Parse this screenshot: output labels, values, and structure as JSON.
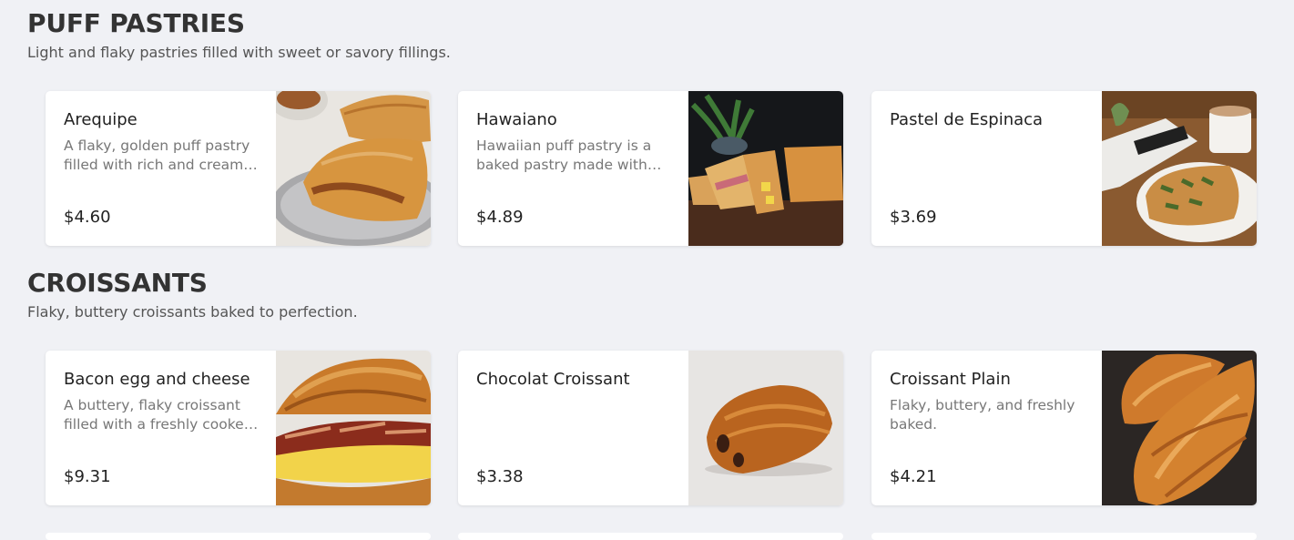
{
  "sections": [
    {
      "title": "PUFF PASTRIES",
      "description": "Light and flaky pastries filled with sweet or savory fillings.",
      "items": [
        {
          "name": "Arequipe",
          "description": "A flaky, golden puff pastry filled with rich and creamy arequipe.",
          "price": "$4.60"
        },
        {
          "name": "Hawaiano",
          "description": "Hawaiian puff pastry is a baked pastry made with ham and pineapple.",
          "price": "$4.89"
        },
        {
          "name": "Pastel de Espinaca",
          "description": "",
          "price": "$3.69"
        }
      ]
    },
    {
      "title": "CROISSANTS",
      "description": "Flaky, buttery croissants baked to perfection.",
      "items": [
        {
          "name": "Bacon egg and cheese",
          "description": "A buttery, flaky croissant filled with a freshly cooked egg, bacon and cheese.",
          "price": "$9.31"
        },
        {
          "name": "Chocolat Croissant",
          "description": "",
          "price": "$3.38"
        },
        {
          "name": "Croissant Plain",
          "description": "Flaky, buttery, and freshly baked.",
          "price": "$4.21"
        }
      ]
    }
  ]
}
